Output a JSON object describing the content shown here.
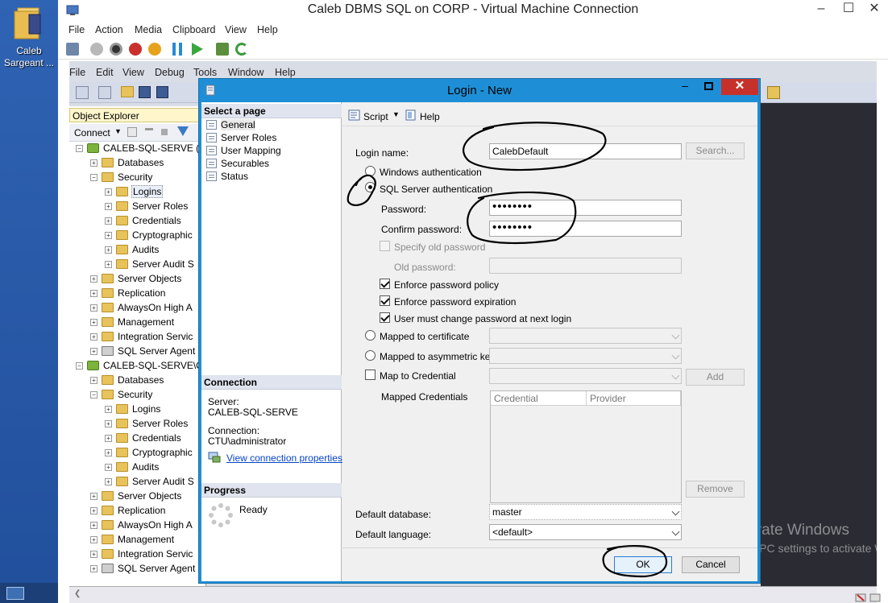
{
  "desktop": {
    "icon_label": "Caleb Sargeant ...",
    "icon_name": "folder-icon"
  },
  "vm_window": {
    "title": "Caleb DBMS SQL on CORP - Virtual Machine Connection",
    "menu": [
      "File",
      "Action",
      "Media",
      "Clipboard",
      "View",
      "Help"
    ]
  },
  "ssms": {
    "menu": [
      "File",
      "Edit",
      "View",
      "Debug",
      "Tools",
      "Window",
      "Help"
    ]
  },
  "object_explorer": {
    "title": "Object Explorer",
    "connect_label": "Connect",
    "tree": [
      {
        "label": "CALEB-SQL-SERVE (S",
        "level": 0,
        "kind": "server",
        "expanded": true
      },
      {
        "label": "Databases",
        "level": 1,
        "kind": "folder"
      },
      {
        "label": "Security",
        "level": 1,
        "kind": "folder",
        "expanded": true
      },
      {
        "label": "Logins",
        "level": 2,
        "kind": "folder",
        "selected": true
      },
      {
        "label": "Server Roles",
        "level": 2,
        "kind": "folder"
      },
      {
        "label": "Credentials",
        "level": 2,
        "kind": "folder"
      },
      {
        "label": "Cryptographic",
        "level": 2,
        "kind": "folder"
      },
      {
        "label": "Audits",
        "level": 2,
        "kind": "folder"
      },
      {
        "label": "Server Audit S",
        "level": 2,
        "kind": "folder"
      },
      {
        "label": "Server Objects",
        "level": 1,
        "kind": "folder"
      },
      {
        "label": "Replication",
        "level": 1,
        "kind": "folder"
      },
      {
        "label": "AlwaysOn High A",
        "level": 1,
        "kind": "folder"
      },
      {
        "label": "Management",
        "level": 1,
        "kind": "folder"
      },
      {
        "label": "Integration Servic",
        "level": 1,
        "kind": "folder"
      },
      {
        "label": "SQL Server Agent",
        "level": 1,
        "kind": "agent"
      },
      {
        "label": "CALEB-SQL-SERVE\\C",
        "level": 0,
        "kind": "server",
        "expanded": true
      },
      {
        "label": "Databases",
        "level": 1,
        "kind": "folder"
      },
      {
        "label": "Security",
        "level": 1,
        "kind": "folder",
        "expanded": true
      },
      {
        "label": "Logins",
        "level": 2,
        "kind": "folder"
      },
      {
        "label": "Server Roles",
        "level": 2,
        "kind": "folder"
      },
      {
        "label": "Credentials",
        "level": 2,
        "kind": "folder"
      },
      {
        "label": "Cryptographic",
        "level": 2,
        "kind": "folder"
      },
      {
        "label": "Audits",
        "level": 2,
        "kind": "folder"
      },
      {
        "label": "Server Audit S",
        "level": 2,
        "kind": "folder"
      },
      {
        "label": "Server Objects",
        "level": 1,
        "kind": "folder"
      },
      {
        "label": "Replication",
        "level": 1,
        "kind": "folder"
      },
      {
        "label": "AlwaysOn High A",
        "level": 1,
        "kind": "folder"
      },
      {
        "label": "Management",
        "level": 1,
        "kind": "folder"
      },
      {
        "label": "Integration Servic",
        "level": 1,
        "kind": "folder"
      },
      {
        "label": "SQL Server Agent",
        "level": 1,
        "kind": "agent"
      }
    ]
  },
  "dialog": {
    "title": "Login - New",
    "select_page_header": "Select a page",
    "pages": [
      "General",
      "Server Roles",
      "User Mapping",
      "Securables",
      "Status"
    ],
    "connection_header": "Connection",
    "server_label": "Server:",
    "server_value": "CALEB-SQL-SERVE",
    "connection_label": "Connection:",
    "connection_value": "CTU\\administrator",
    "view_connection_link": "View connection properties",
    "progress_header": "Progress",
    "progress_status": "Ready",
    "toolbar": {
      "script": "Script",
      "help": "Help"
    },
    "login_name_label": "Login name:",
    "login_name_value": "CalebDefault",
    "search_button": "Search...",
    "windows_auth": "Windows authentication",
    "sql_auth": "SQL Server authentication",
    "password_label": "Password:",
    "password_value": "••••••••",
    "confirm_password_label": "Confirm password:",
    "confirm_password_value": "••••••••",
    "specify_old_password": "Specify old password",
    "old_password_label": "Old password:",
    "enforce_policy": "Enforce password policy",
    "enforce_expiration": "Enforce password expiration",
    "must_change": "User must change password at next login",
    "mapped_cert": "Mapped to certificate",
    "mapped_asym": "Mapped to asymmetric key",
    "map_credential": "Map to Credential",
    "add_button": "Add",
    "mapped_credentials_label": "Mapped Credentials",
    "grid_headers": [
      "Credential",
      "Provider"
    ],
    "remove_button": "Remove",
    "default_database_label": "Default database:",
    "default_database_value": "master",
    "default_language_label": "Default language:",
    "default_language_value": "<default>",
    "ok_button": "OK",
    "cancel_button": "Cancel"
  },
  "watermark": {
    "line1": "Activate Windows",
    "line2": "Go to PC settings to activate W"
  },
  "colors": {
    "dialog_frame": "#1e8fd6",
    "close_button": "#c7312b",
    "desktop": "#2a5ba8"
  }
}
